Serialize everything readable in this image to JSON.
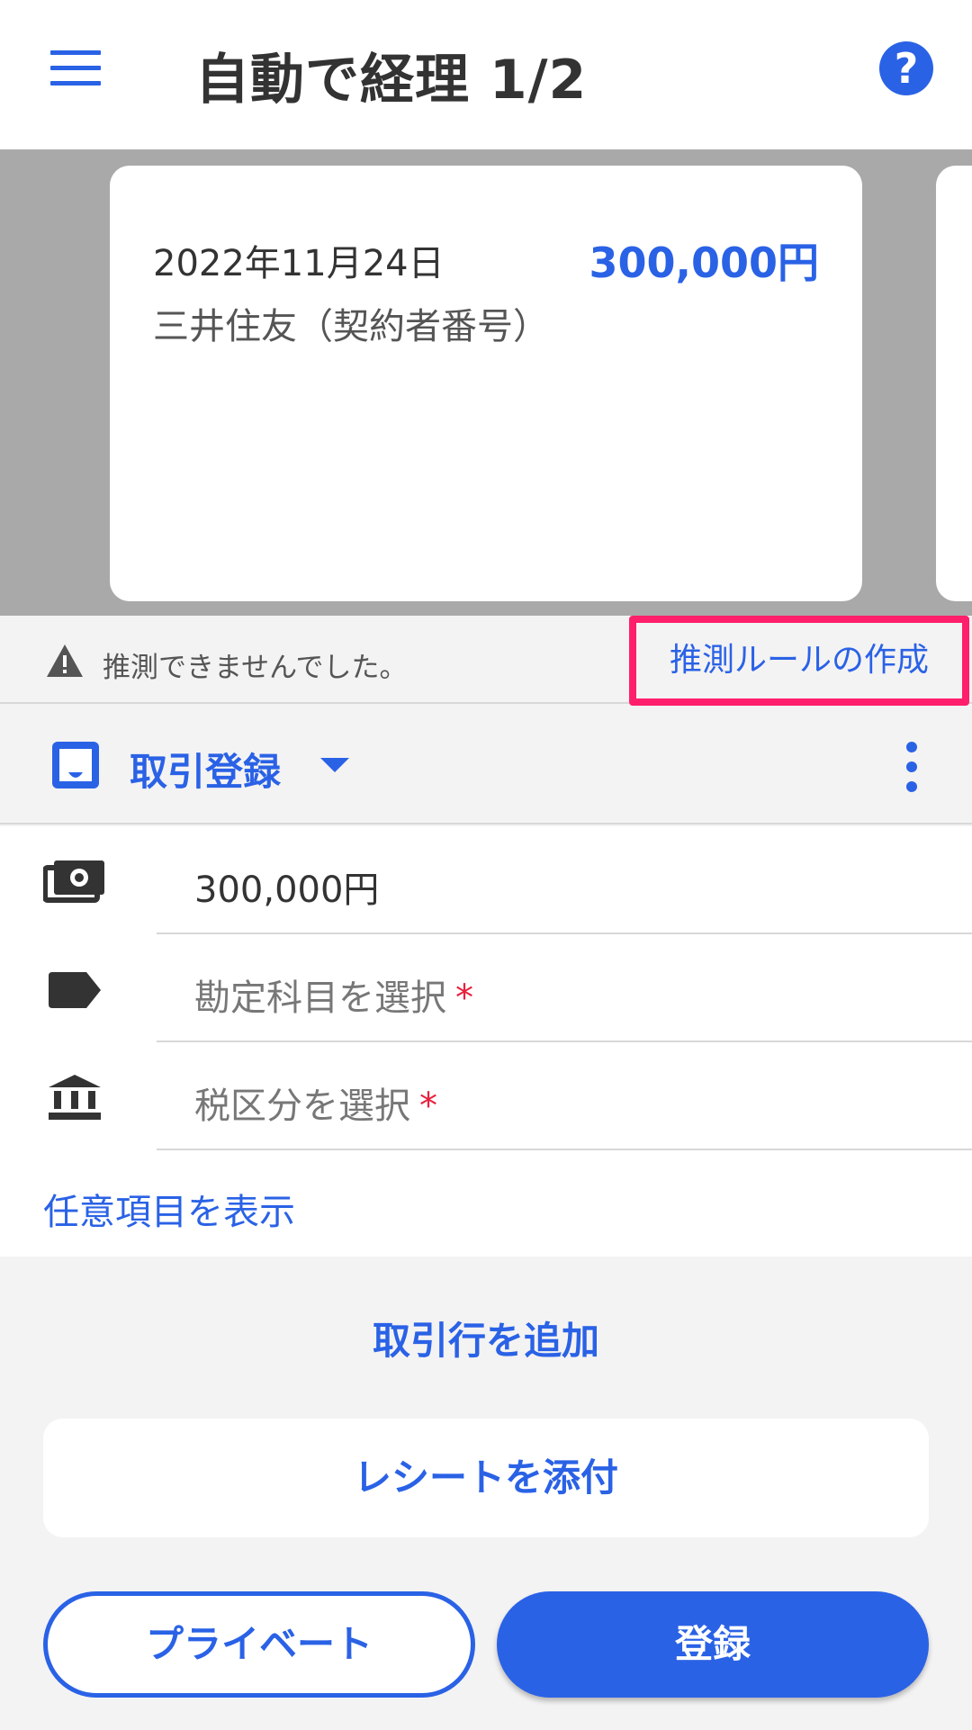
{
  "header": {
    "title": "自動で経理 1/2",
    "menu_icon": "hamburger-menu-icon",
    "help_icon": "help-circle-icon",
    "help_glyph": "?"
  },
  "card": {
    "date": "2022年11月24日",
    "amount": "300,000円",
    "bank": "三井住友（契約者番号）"
  },
  "infobar": {
    "warning_icon": "warning-triangle-icon",
    "message": "推測できませんでした。",
    "rule_link": "推測ルールの作成"
  },
  "entry": {
    "type_label": "取引登録",
    "type_icon": "inbox-icon",
    "caret_icon": "caret-down-icon",
    "more_icon": "kebab-menu-icon"
  },
  "form": {
    "amount": {
      "icon": "money-icon",
      "value": "300,000円"
    },
    "account": {
      "icon": "tag-icon",
      "placeholder": "勘定科目を選択",
      "required": "*"
    },
    "tax": {
      "icon": "bank-building-icon",
      "placeholder": "税区分を選択",
      "required": "*"
    },
    "optional_link": "任意項目を表示"
  },
  "actions": {
    "add_line": "取引行を追加",
    "attach_receipt": "レシートを添付",
    "private": "プライベート",
    "register": "登録"
  },
  "colors": {
    "accent": "#2a62e6",
    "highlight": "#ff1f6b",
    "required": "#e8203c"
  }
}
